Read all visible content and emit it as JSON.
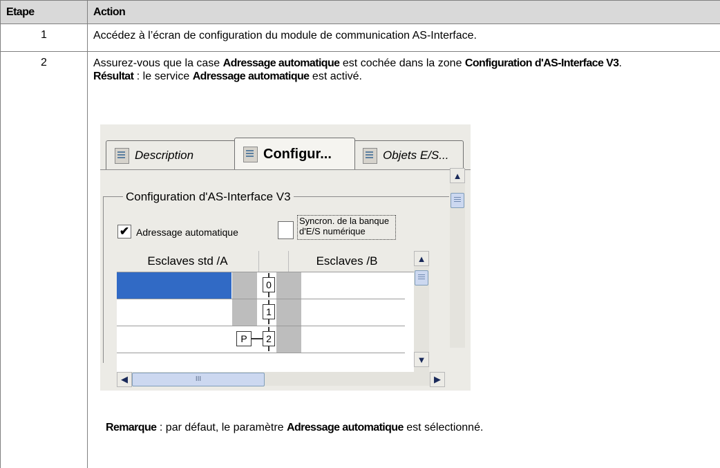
{
  "table": {
    "headers": [
      "Etape",
      "Action"
    ],
    "rows": [
      {
        "step": "1",
        "text": "Accédez à l’écran de configuration du module de communication AS-Interface."
      },
      {
        "step": "2",
        "line1": {
          "p1": "Assurez-vous que la case ",
          "b1": "Adressage automatique",
          "p2": " est cochée dans la zone ",
          "b2": "Configuration d'AS-Interface V3",
          "p3": "."
        },
        "result": {
          "b1": "Résultat",
          "p1": " : le service ",
          "b2": "Adressage automatique",
          "p2": " est activé."
        },
        "note": {
          "b1": "Remarque",
          "p1": " : par défaut, le paramètre ",
          "b2": "Adressage automatique",
          "p2": " est sélectionné."
        }
      }
    ]
  },
  "screenshot": {
    "tabs": [
      "Description",
      "Configur...",
      "Objets E/S..."
    ],
    "group_label": "Configuration d'AS-Interface V3",
    "checkbox_auto": {
      "label": "Adressage automatique",
      "checked_glyph": "✔"
    },
    "sync_label": "Syncron. de la banque d'E/S numérique",
    "grid": {
      "col_a": "Esclaves std /A",
      "col_b": "Esclaves /B",
      "addresses": [
        "0",
        "1",
        "2"
      ],
      "p_marker": "P"
    },
    "scroll": {
      "up": "▲",
      "down": "▼",
      "left": "◀",
      "right": "▶",
      "thumb_grip": "III"
    }
  }
}
